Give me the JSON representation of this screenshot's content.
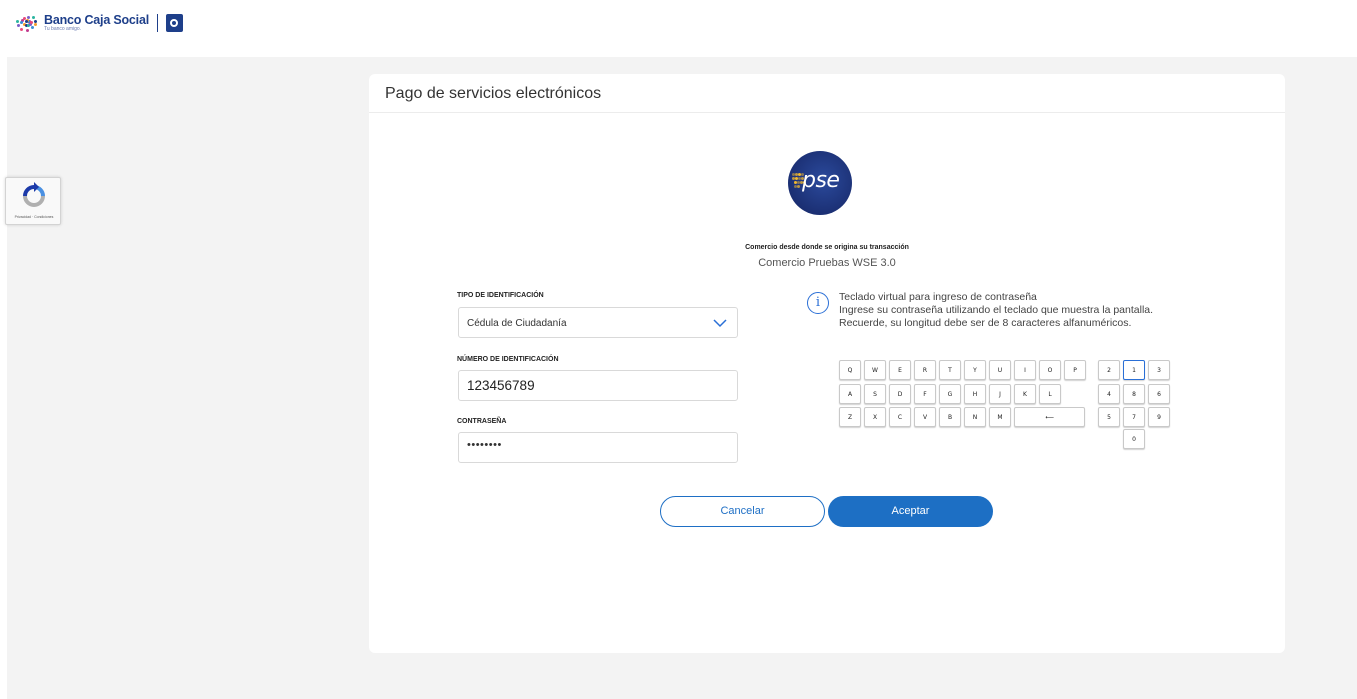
{
  "header": {
    "brand_name": "Banco Caja Social",
    "brand_tagline": "Tu banco amigo."
  },
  "recaptcha": {
    "label": "Privacidad · Condiciones"
  },
  "card": {
    "title": "Pago de servicios electrónicos",
    "pse_logo_text": "pse",
    "origin_label": "Comercio desde donde se origina su transacción",
    "origin_value": "Comercio Pruebas WSE 3.0"
  },
  "form": {
    "id_type_label": "TIPO DE IDENTIFICACIÓN",
    "id_type_value": "Cédula de Ciudadanía",
    "id_number_label": "NÚMERO DE IDENTIFICACIÓN",
    "id_number_value": "123456789",
    "password_label": "CONTRASEÑA",
    "password_value": "••••••••"
  },
  "info": {
    "icon_glyph": "i",
    "line1": "Teclado virtual para ingreso de contraseña",
    "line2": "Ingrese su contraseña utilizando el teclado que muestra la pantalla.",
    "line3": "Recuerde, su longitud debe ser de 8 caracteres alfanuméricos."
  },
  "keyboard": {
    "letters_row1": [
      "Q",
      "W",
      "E",
      "R",
      "T",
      "Y",
      "U",
      "I",
      "O",
      "P"
    ],
    "letters_row2": [
      "A",
      "S",
      "D",
      "F",
      "G",
      "H",
      "J",
      "K",
      "L"
    ],
    "letters_row3": [
      "Z",
      "X",
      "C",
      "V",
      "B",
      "N",
      "M"
    ],
    "backspace": "⟵",
    "digits_row1": [
      "2",
      "1",
      "3"
    ],
    "digits_row2": [
      "4",
      "8",
      "6"
    ],
    "digits_row3": [
      "5",
      "7",
      "9"
    ],
    "digits_row4": [
      "0"
    ],
    "active_key": "1"
  },
  "buttons": {
    "cancel": "Cancelar",
    "accept": "Aceptar"
  },
  "colors": {
    "accent": "#1d6fc4",
    "brand": "#1e3f8a",
    "background": "#f3f3f3"
  }
}
